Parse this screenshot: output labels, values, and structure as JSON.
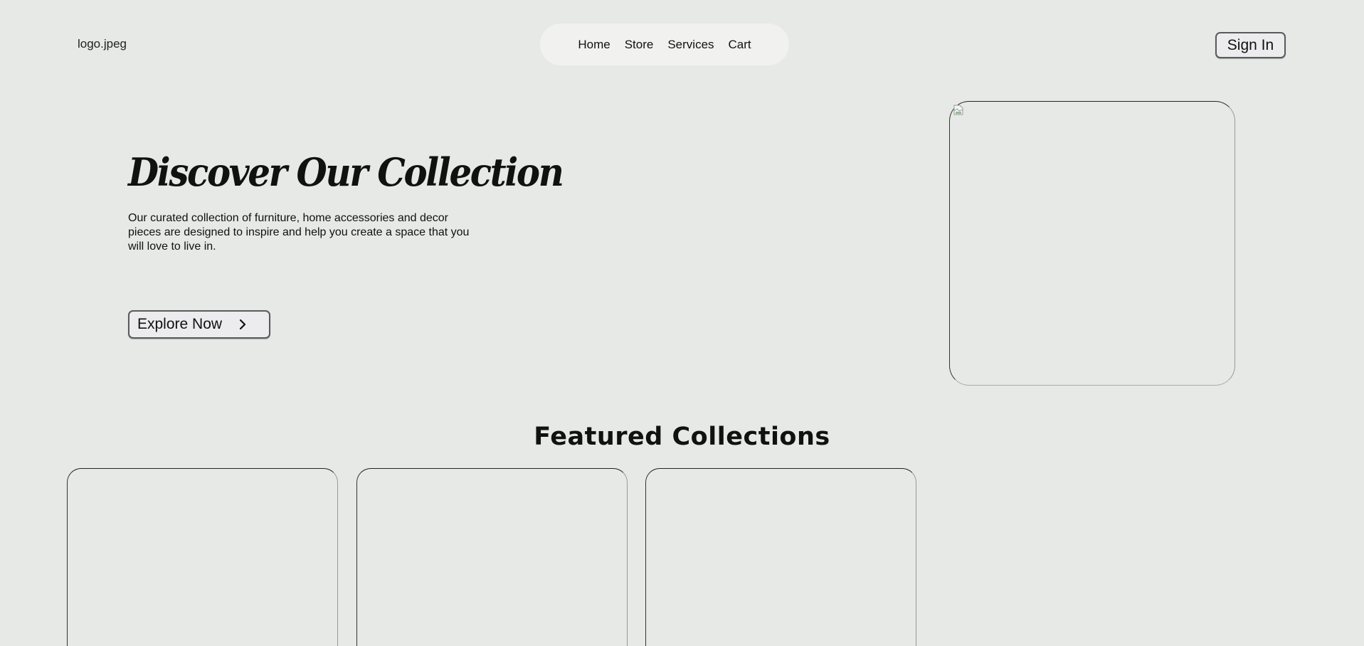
{
  "header": {
    "logo_text": "logo.jpeg",
    "nav": [
      "Home",
      "Store",
      "Services",
      "Cart"
    ],
    "signin_label": "Sign In"
  },
  "hero": {
    "title": "Discover Our Collection",
    "description": "Our curated collection of furniture, home accessories and decor pieces are designed to inspire and help you create a space that you will love to live in.",
    "cta_label": "Explore Now",
    "cta_icon": "chevron-right-icon",
    "image_icon": "broken-image-icon"
  },
  "featured": {
    "title": "Featured Collections"
  }
}
